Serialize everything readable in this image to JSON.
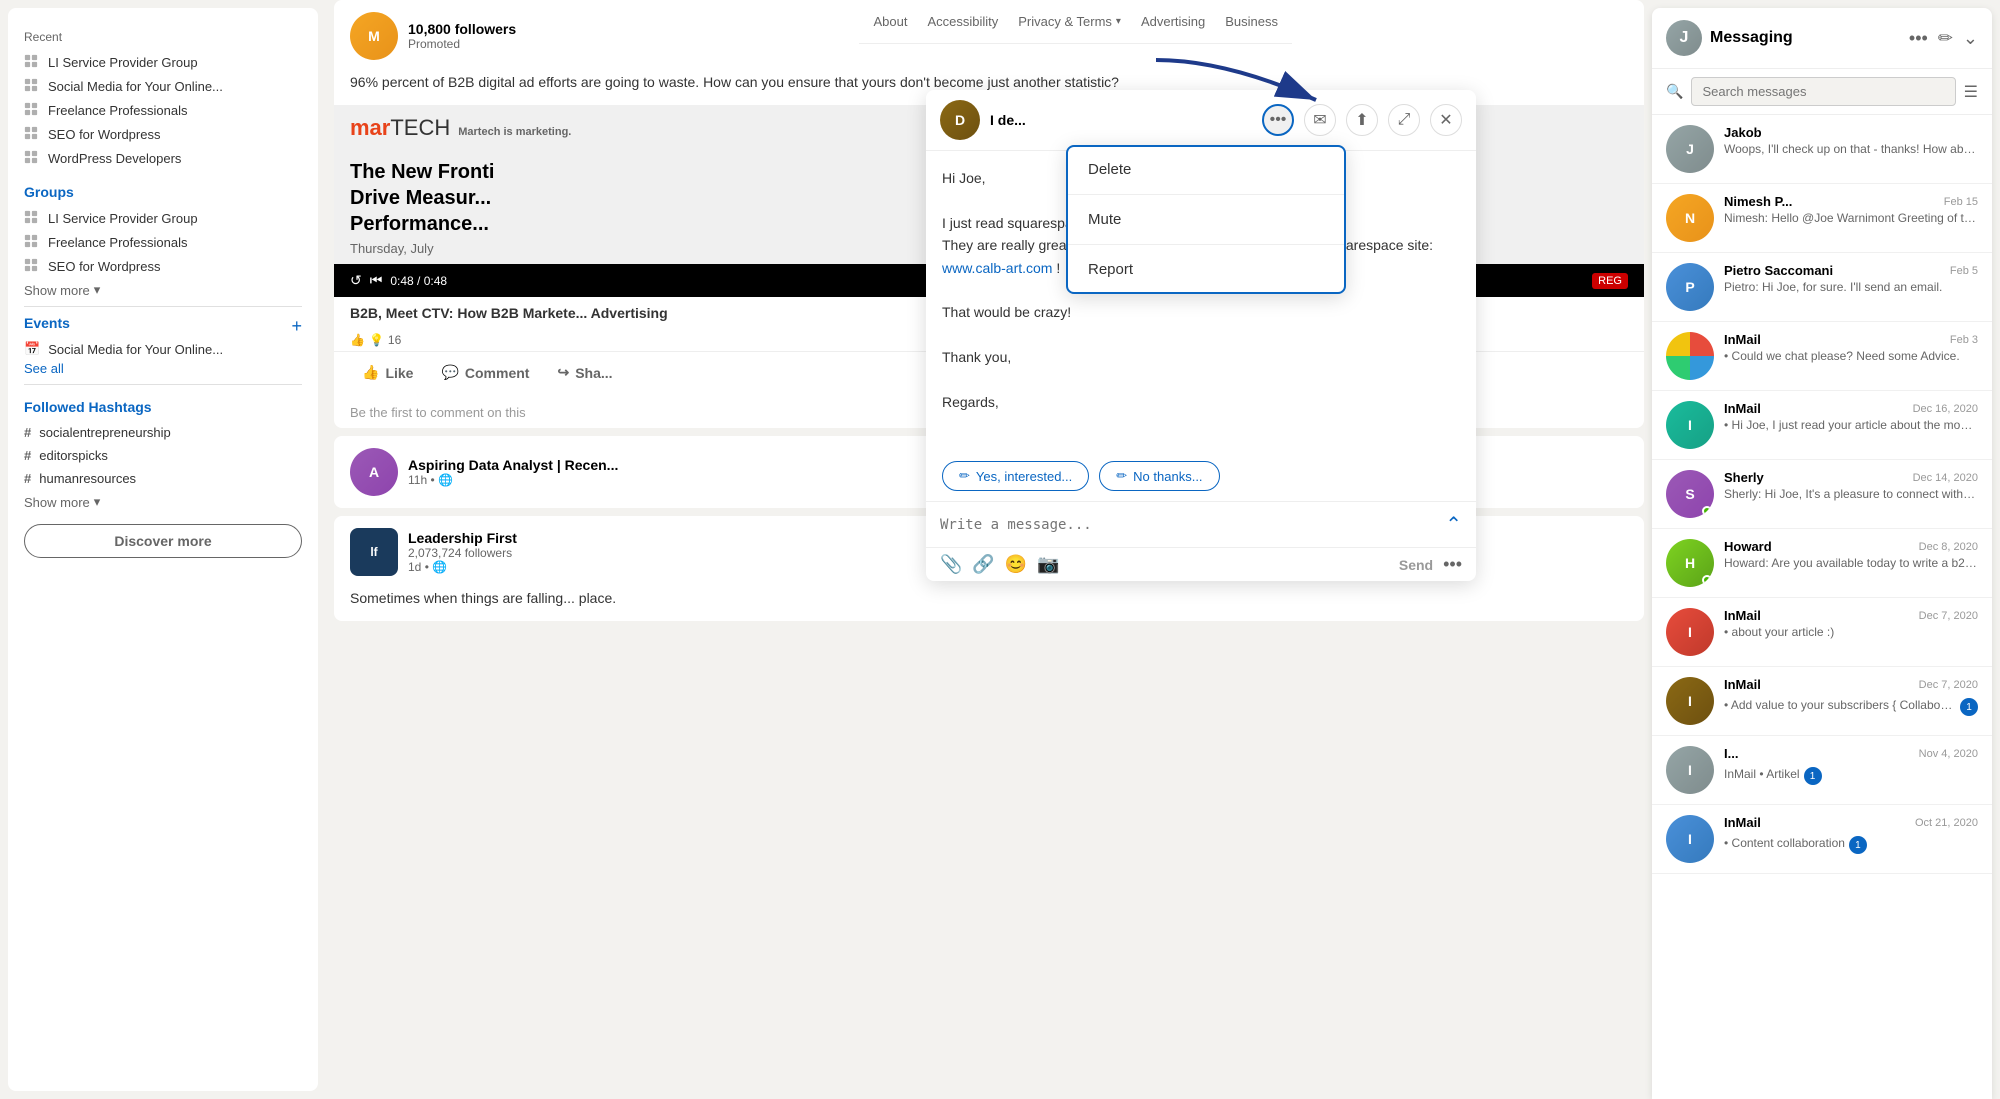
{
  "sidebar": {
    "recent_label": "Recent",
    "recent_items": [
      {
        "id": "li-service-provider",
        "label": "LI Service Provider Group",
        "icon": "grid"
      },
      {
        "id": "social-media",
        "label": "Social Media for Your Online...",
        "icon": "grid"
      },
      {
        "id": "freelance-professionals",
        "label": "Freelance Professionals",
        "icon": "grid"
      },
      {
        "id": "seo-wordpress",
        "label": "SEO for Wordpress",
        "icon": "grid"
      },
      {
        "id": "wordpress-developers",
        "label": "WordPress Developers",
        "icon": "grid"
      }
    ],
    "groups_label": "Groups",
    "group_items": [
      {
        "id": "li-service-provider-g",
        "label": "LI Service Provider Group",
        "icon": "grid"
      },
      {
        "id": "freelance-professionals-g",
        "label": "Freelance Professionals",
        "icon": "grid"
      },
      {
        "id": "seo-wordpress-g",
        "label": "SEO for Wordpress",
        "icon": "grid"
      }
    ],
    "show_more": "Show more",
    "events_label": "Events",
    "events_add_icon": "+",
    "event_items": [
      {
        "id": "social-media-event",
        "label": "Social Media for Your Online..."
      }
    ],
    "see_all": "See all",
    "hashtags_label": "Followed Hashtags",
    "hashtag_items": [
      {
        "id": "socialentrepreneurship",
        "label": "#socialentrepreneurship"
      },
      {
        "id": "editorspicks",
        "label": "#editorspicks"
      },
      {
        "id": "humanresources",
        "label": "#humanresources"
      }
    ],
    "show_more_hashtags": "Show more",
    "discover_more": "Discover more"
  },
  "top_links": {
    "about": "About",
    "accessibility": "Accessibility",
    "privacy_terms": "Privacy & Terms",
    "dropdown_arrow": "▾",
    "advertising": "Advertising",
    "business": "Business"
  },
  "feed": {
    "card1": {
      "promo_text": "96% percent of B2B digital ad efforts are going to waste. How can you ensure that yours don't become just another statistic?",
      "promoted": "Promoted",
      "followers": "10,800 followers",
      "martech_logo": "mar TECH",
      "article_title": "The New Fronti... Drive Measur... Performance...",
      "date": "Thursday, July",
      "video_time": "0:48 / 0:48",
      "reg_badge": "REG",
      "article_subtitle": "B2B, Meet CTV: How B2B Markete... Advertising",
      "reactions_count": "16",
      "like": "Like",
      "comment": "Comment",
      "share": "Sha..."
    },
    "card2": {
      "name": "Aspiring Data Analyst | Recen...",
      "time": "11h",
      "visibility": "🌐"
    },
    "card3": {
      "name": "Leadership First",
      "followers": "2,073,724 followers",
      "time": "1d",
      "text": "Sometimes when things are falling... place.",
      "logo_text": "lf"
    }
  },
  "message_overlay": {
    "name": "I de...",
    "greeting": "Hi Joe,",
    "body1": "I just read",
    "body2": "squarespace sites.",
    "body3": "They are really great! I would like to have your opinion on my squarespace site:",
    "link": "www.calb-art.com",
    "body4": "!",
    "crazy": "That would be crazy!",
    "thanks": "Thank you,",
    "regards": "Regards,",
    "suggestion1": "Yes, interested...",
    "suggestion2": "No thanks...",
    "write_placeholder": "Write a message...",
    "send": "Send"
  },
  "context_menu": {
    "delete": "Delete",
    "mute": "Mute",
    "report": "Report"
  },
  "messaging": {
    "title": "Messaging",
    "search_placeholder": "Search messages",
    "conversations": [
      {
        "id": "jakob",
        "name": "Jakob",
        "date": "",
        "preview": "Woops, I'll check up on that - thanks! How about...",
        "avatar_color": "av-gray",
        "avatar_text": "J",
        "badge": false,
        "online": false
      },
      {
        "id": "nimesh",
        "name": "Nimesh P...",
        "date": "Feb 15",
        "preview": "Nimesh: Hello @Joe Warnimont Greeting of the Day! Kindly...",
        "avatar_color": "av-orange",
        "avatar_text": "N",
        "badge": false,
        "online": false
      },
      {
        "id": "pietro",
        "name": "Pietro Saccomani",
        "date": "Feb 5",
        "preview": "Pietro: Hi Joe, for sure. I'll send an email.",
        "avatar_color": "av-blue",
        "avatar_text": "P",
        "badge": false,
        "online": false
      },
      {
        "id": "inmail-feb3",
        "name": "InMail",
        "date": "Feb 3",
        "preview": "• Could we chat please? Need some Advice.",
        "avatar_color": "av-multi",
        "avatar_text": "",
        "badge": false,
        "online": false
      },
      {
        "id": "inmail-dec16",
        "name": "InMail",
        "date": "Dec 16, 2020",
        "preview": "• Hi Joe, I just read your article about the most beautif...",
        "avatar_color": "av-teal",
        "avatar_text": "I",
        "badge": false,
        "online": false
      },
      {
        "id": "sherly",
        "name": "Sherly",
        "date": "Dec 14, 2020",
        "preview": "Sherly: Hi Joe, It's a pleasure to connect with you on LinkedIn....",
        "avatar_color": "av-purple",
        "avatar_text": "S",
        "badge": false,
        "online": true
      },
      {
        "id": "howard",
        "name": "Howard",
        "date": "Dec 8, 2020",
        "preview": "Howard: Are you available today to write a b2b email?",
        "avatar_color": "av-green",
        "avatar_text": "H",
        "badge": false,
        "online": true
      },
      {
        "id": "inmail-dec7-1",
        "name": "InMail",
        "date": "Dec 7, 2020",
        "preview": "• about your article :)",
        "avatar_color": "av-red",
        "avatar_text": "I",
        "badge": false,
        "online": false
      },
      {
        "id": "inmail-dec7-2",
        "name": "InMail",
        "date": "Dec 7, 2020",
        "preview": "• Add value to your subscribers { Collaboration }",
        "avatar_color": "av-brown",
        "avatar_text": "I",
        "badge": 1,
        "online": false
      },
      {
        "id": "inmail-nov4",
        "name": "I...",
        "date": "Nov 4, 2020",
        "preview": "InMail • Artikel",
        "avatar_color": "av-gray",
        "avatar_text": "I",
        "badge": 1,
        "online": false
      },
      {
        "id": "inmail-oct21",
        "name": "InMail",
        "date": "Oct 21, 2020",
        "preview": "• Content collaboration",
        "avatar_color": "av-blue",
        "avatar_text": "I",
        "badge": 1,
        "online": false
      }
    ]
  }
}
